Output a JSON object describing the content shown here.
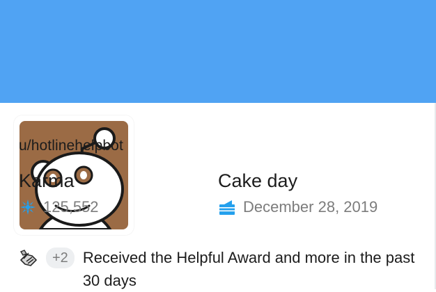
{
  "profile": {
    "username": "u/hotlinehelpbot",
    "karma_label": "Karma",
    "karma_value": "125,552",
    "cakeday_label": "Cake day",
    "cakeday_value": "December 28, 2019"
  },
  "awards": {
    "count_badge": "+2",
    "summary": "Received the Helpful Award and more in the past 30 days"
  },
  "icons": {
    "karma": "karma-sparkle-icon",
    "cakeday": "cake-icon",
    "award": "helpful-award-icon"
  },
  "colors": {
    "banner": "#50a3f3",
    "avatar_background": "#9b6b45",
    "karma_icon": "#24a0ed",
    "muted_text": "#7c7c7c"
  }
}
